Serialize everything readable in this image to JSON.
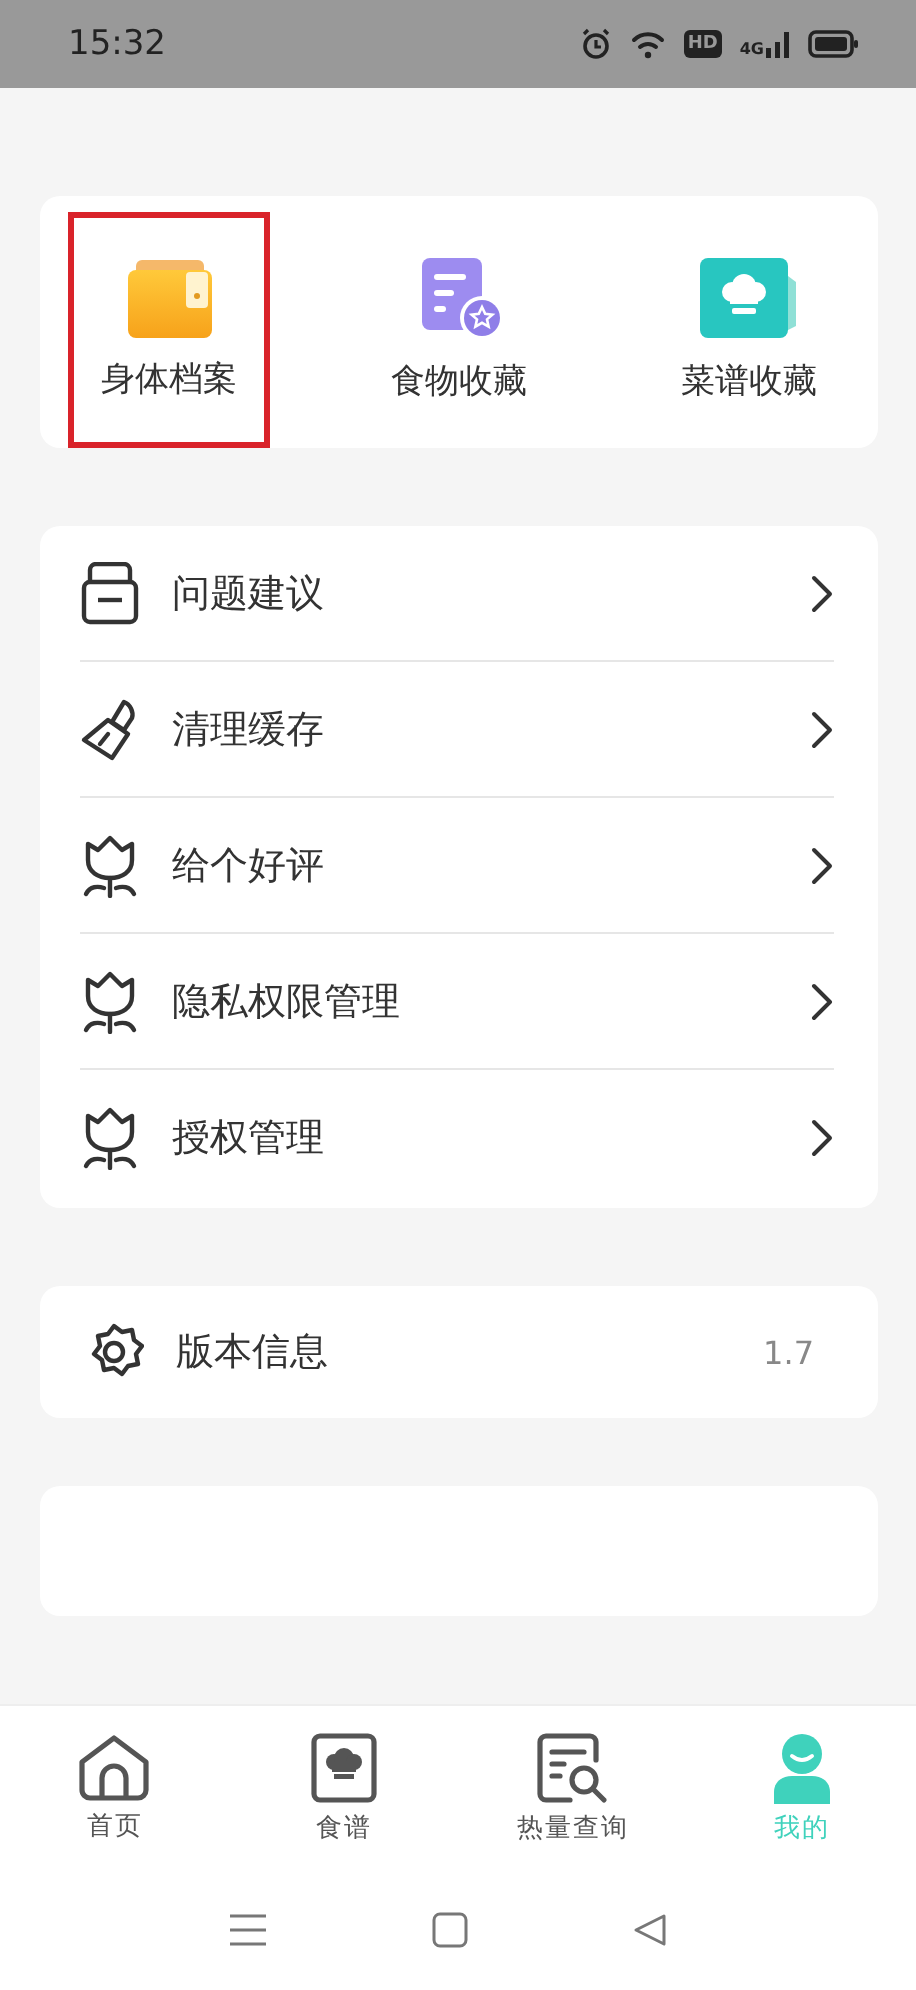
{
  "status_bar": {
    "time": "15:32",
    "hd": "HD",
    "network": "4G"
  },
  "shortcuts": [
    {
      "label": "身体档案",
      "kind": "wallet",
      "highlighted": true
    },
    {
      "label": "食物收藏",
      "kind": "document-star",
      "highlighted": false
    },
    {
      "label": "菜谱收藏",
      "kind": "chef",
      "highlighted": false
    }
  ],
  "menu": [
    {
      "label": "问题建议",
      "kind": "inbox"
    },
    {
      "label": "清理缓存",
      "kind": "brush"
    },
    {
      "label": "给个好评",
      "kind": "flower"
    },
    {
      "label": "隐私权限管理",
      "kind": "flower"
    },
    {
      "label": "授权管理",
      "kind": "flower"
    }
  ],
  "version": {
    "label": "版本信息",
    "value": "1.7"
  },
  "tabs": [
    {
      "label": "首页",
      "kind": "home",
      "selected": false
    },
    {
      "label": "食谱",
      "kind": "chef",
      "selected": false
    },
    {
      "label": "热量查询",
      "kind": "search-doc",
      "selected": false
    },
    {
      "label": "我的",
      "kind": "person",
      "selected": true
    }
  ]
}
